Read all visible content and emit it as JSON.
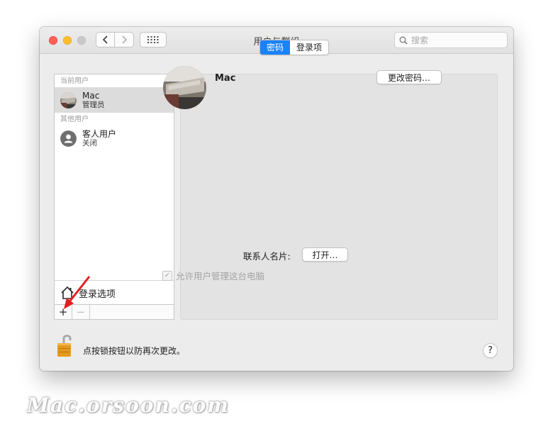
{
  "window": {
    "title": "用户与群组"
  },
  "search": {
    "placeholder": "搜索"
  },
  "sidebar": {
    "current_header": "当前用户",
    "other_header": "其他用户",
    "current_user": {
      "name": "Mac",
      "role": "管理员"
    },
    "other_users": [
      {
        "name": "客人用户",
        "status": "关闭"
      }
    ],
    "login_options": "登录选项",
    "add_label": "+",
    "remove_label": "−"
  },
  "tabs": [
    {
      "label": "密码",
      "active": true
    },
    {
      "label": "登录项",
      "active": false
    }
  ],
  "main": {
    "user_name": "Mac",
    "change_password": "更改密码…",
    "contact_card_label": "联系人名片:",
    "open_button": "打开…",
    "allow_admin_label": "允许用户管理这台电脑",
    "allow_admin_checked": true
  },
  "footer": {
    "lock_text": "点按锁按钮以防再次更改。",
    "help": "?"
  },
  "watermark": "Mac.orsoon.com",
  "colors": {
    "accent": "#1a82fb",
    "close": "#ff5f57",
    "minimize": "#febc2e",
    "arrow": "#e02020"
  }
}
